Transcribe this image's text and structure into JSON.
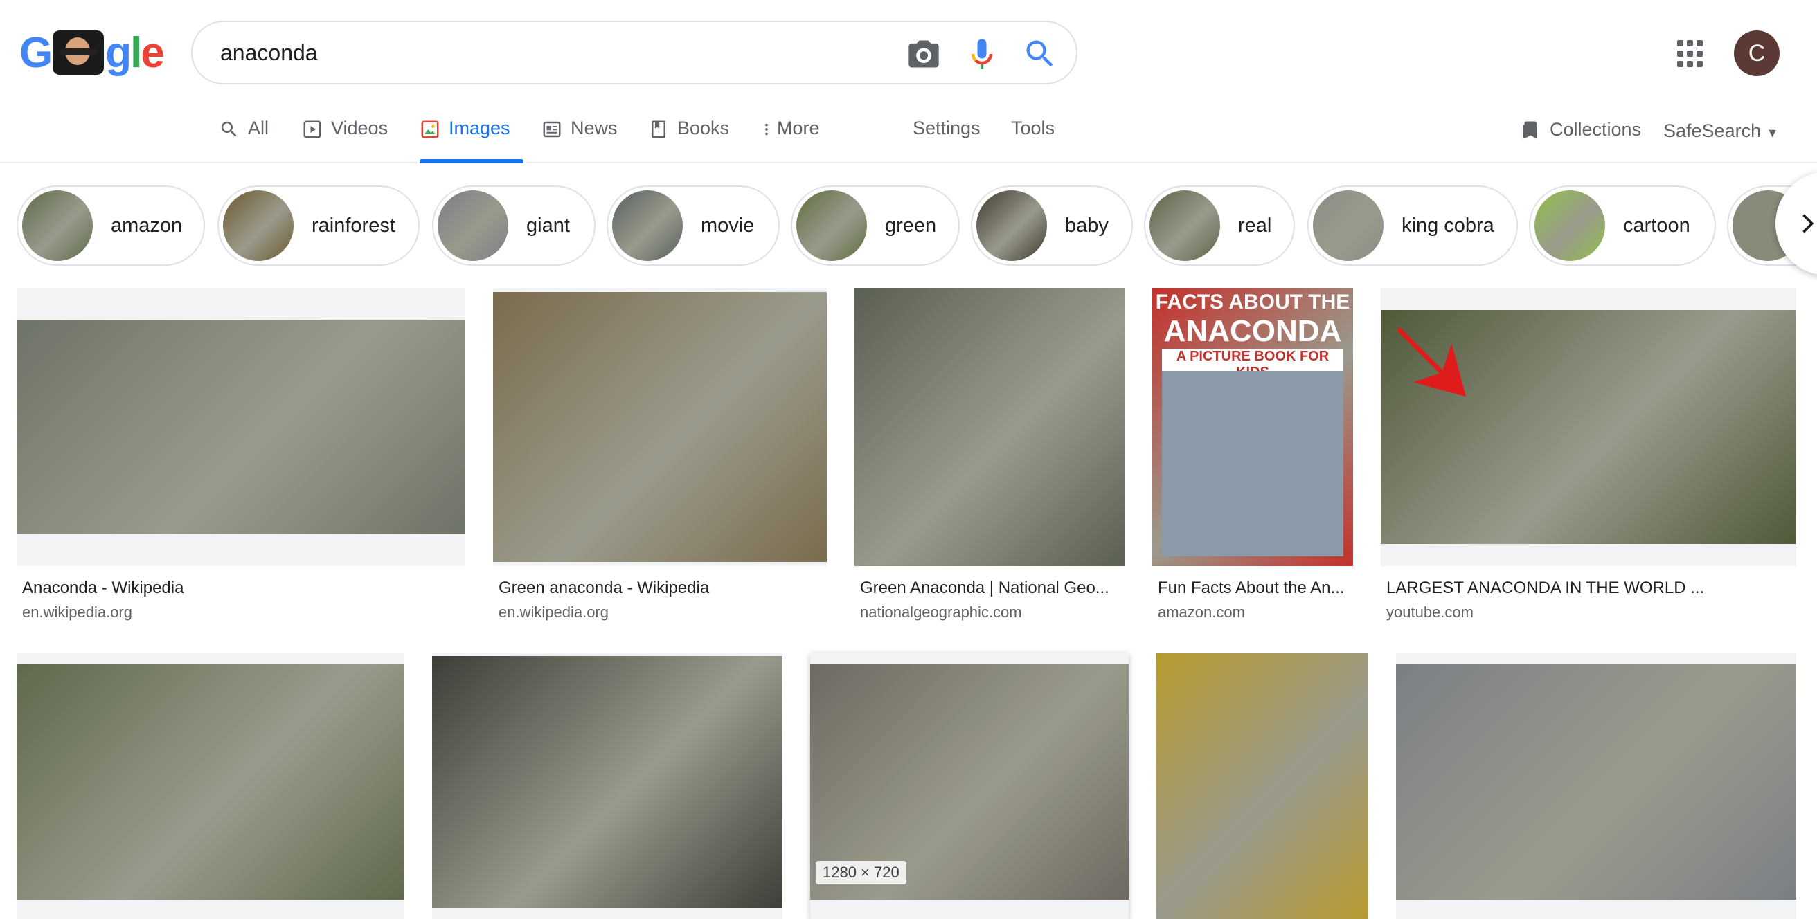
{
  "search": {
    "query": "anaconda"
  },
  "user": {
    "avatar_letter": "C"
  },
  "tabs": [
    {
      "label": "All",
      "icon": "search-icon"
    },
    {
      "label": "Videos",
      "icon": "video-icon"
    },
    {
      "label": "Images",
      "icon": "image-icon",
      "active": true
    },
    {
      "label": "News",
      "icon": "news-icon"
    },
    {
      "label": "Books",
      "icon": "book-icon"
    },
    {
      "label": "More",
      "icon": "more-vert-icon"
    }
  ],
  "tools": {
    "settings": "Settings",
    "tools": "Tools",
    "collections": "Collections",
    "safesearch": "SafeSearch"
  },
  "chips": [
    {
      "label": "amazon",
      "color": "#5d6b4a"
    },
    {
      "label": "rainforest",
      "color": "#6b5a2e"
    },
    {
      "label": "giant",
      "color": "#7a7f86"
    },
    {
      "label": "movie",
      "color": "#566060"
    },
    {
      "label": "green",
      "color": "#5e6e3e"
    },
    {
      "label": "baby",
      "color": "#3e3a30"
    },
    {
      "label": "real",
      "color": "#5c6548"
    },
    {
      "label": "king cobra",
      "color": "#8c8c86"
    },
    {
      "label": "cartoon",
      "color": "#8fc04a"
    }
  ],
  "results_row1": [
    {
      "title": "Anaconda - Wikipedia",
      "site": "en.wikipedia.org",
      "color": "#6f7468"
    },
    {
      "title": "Green anaconda - Wikipedia",
      "site": "en.wikipedia.org",
      "color": "#7b6c4e"
    },
    {
      "title": "Green Anaconda | National Geo...",
      "site": "nationalgeographic.com",
      "color": "#5a6052"
    },
    {
      "title": "Fun Facts About the An...",
      "site": "amazon.com",
      "color": "#c4302b",
      "book_line1": "FACTS ABOUT THE",
      "book_line2": "ANACONDA",
      "book_line3": "A PICTURE BOOK FOR KIDS"
    },
    {
      "title": "LARGEST ANACONDA IN THE WORLD ...",
      "site": "youtube.com",
      "color": "#4f5a3a"
    }
  ],
  "results_row2": [
    {
      "color": "#5f6a4d"
    },
    {
      "color": "#3c3f38"
    },
    {
      "color": "#6e6a62",
      "dimensions": "1280 × 720"
    },
    {
      "color": "#b79a2e"
    },
    {
      "color": "#7b7f84"
    }
  ]
}
